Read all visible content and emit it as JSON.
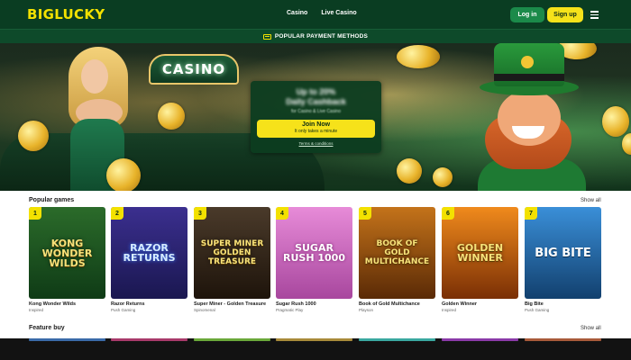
{
  "header": {
    "logo": "BIGLUCKY",
    "nav": [
      "Casino",
      "Live Casino"
    ],
    "login": "Log in",
    "signup": "Sign up"
  },
  "paybar": {
    "label": "POPULAR PAYMENT METHODS"
  },
  "hero": {
    "sign": "CASINO",
    "promo": {
      "line1": "Up to 20%",
      "line2": "Daily Cashback",
      "line3": "for Casino & Live Casino",
      "join_main": "Join Now",
      "join_sub": "It only takes a minute",
      "terms": "Terms & conditions"
    }
  },
  "popular": {
    "title": "Popular games",
    "show_all": "Show all",
    "games": [
      {
        "rank": "1",
        "name": "Kong Wonder Wilds",
        "provider": "Inspired",
        "art": "KONG WONDER WILDS"
      },
      {
        "rank": "2",
        "name": "Razor Returns",
        "provider": "Push Gaming",
        "art": "RAZOR RETURNS"
      },
      {
        "rank": "3",
        "name": "Super Miner - Golden Treasure",
        "provider": "Spinomenal",
        "art": "SUPER MINER GOLDEN TREASURE"
      },
      {
        "rank": "4",
        "name": "Sugar Rush 1000",
        "provider": "Pragmatic Play",
        "art": "SUGAR RUSH 1000"
      },
      {
        "rank": "5",
        "name": "Book of Gold Multichance",
        "provider": "Playson",
        "art": "BOOK OF GOLD MULTICHANCE"
      },
      {
        "rank": "6",
        "name": "Golden Winner",
        "provider": "Inspired",
        "art": "GOLDEN WINNER"
      },
      {
        "rank": "7",
        "name": "Big Bite",
        "provider": "Push Gaming",
        "art": "BIG BITE"
      }
    ]
  },
  "feature": {
    "title": "Feature buy",
    "show_all": "Show all"
  }
}
